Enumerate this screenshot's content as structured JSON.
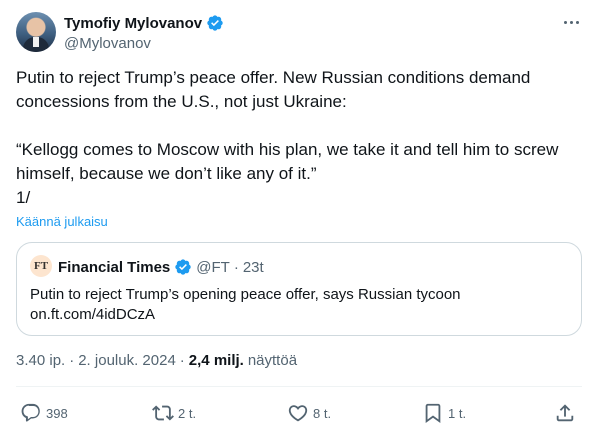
{
  "author": {
    "name": "Tymofiy Mylovanov",
    "handle": "@Mylovanov"
  },
  "tweet": {
    "text": "Putin to reject Trump’s peace offer. New Russian conditions demand concessions from the U.S., not just Ukraine:\n\n“Kellogg comes to Moscow with his plan, we take it and tell him to screw himself, because we don’t like any of it.”\n1/",
    "translate_label": "Käännä julkaisu"
  },
  "quote": {
    "logo_text": "FT",
    "name": "Financial Times",
    "handle": "@FT",
    "separator": "·",
    "age": "23t",
    "text": "Putin to reject Trump’s opening peace offer, says Russian tycoon\non.ft.com/4idDCzA"
  },
  "meta": {
    "time": "3.40 ip.",
    "separator1": "·",
    "date": "2. jouluk. 2024",
    "separator2": "·",
    "views": "2,4 milj.",
    "views_label": "näyttöä"
  },
  "actions": {
    "replies": "398",
    "reposts": "2 t.",
    "likes": "8 t.",
    "bookmarks": "1 t."
  },
  "colors": {
    "accent": "#1d9bf0",
    "text": "#0f1419",
    "secondary": "#536471",
    "border": "#cfd9de",
    "verified_gold": "#1d9bf0"
  }
}
